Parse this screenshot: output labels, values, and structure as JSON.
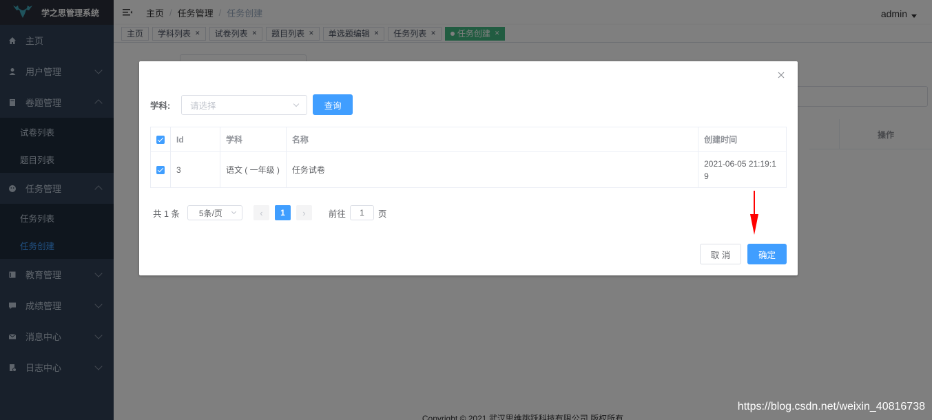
{
  "app_title": "学之思管理系统",
  "sidebar": {
    "items": [
      {
        "label": "主页",
        "icon": "home-icon"
      },
      {
        "label": "用户管理",
        "icon": "user-icon"
      },
      {
        "label": "卷题管理",
        "icon": "book-icon"
      },
      {
        "label": "试卷列表"
      },
      {
        "label": "题目列表"
      },
      {
        "label": "任务管理",
        "icon": "smile-icon"
      },
      {
        "label": "任务列表"
      },
      {
        "label": "任务创建"
      },
      {
        "label": "教育管理",
        "icon": "education-icon"
      },
      {
        "label": "成绩管理",
        "icon": "chat-icon"
      },
      {
        "label": "消息中心",
        "icon": "mail-icon"
      },
      {
        "label": "日志中心",
        "icon": "log-icon"
      }
    ]
  },
  "breadcrumb": [
    "主页",
    "任务管理",
    "任务创建"
  ],
  "user": "admin",
  "tags": [
    "主页",
    "学科列表",
    "试卷列表",
    "题目列表",
    "单选题编辑",
    "任务列表",
    "任务创建"
  ],
  "background": {
    "op_label": "操作",
    "footer": "Copyright © 2021 武汉思维跳跃科技有限公司 版权所有"
  },
  "dialog": {
    "filter_label": "学科:",
    "select_placeholder": "请选择",
    "query_button": "查询",
    "columns": [
      "Id",
      "学科",
      "名称",
      "创建时间"
    ],
    "rows": [
      {
        "id": "3",
        "subject": "语文 ( 一年级 )",
        "name": "任务试卷",
        "created": "2021-06-05 21:19:19"
      }
    ],
    "pagination": {
      "total": "共 1 条",
      "page_size": "5条/页",
      "current": "1",
      "goto_label": "前往",
      "goto_value": "1",
      "page_suffix": "页"
    },
    "cancel_button": "取 消",
    "confirm_button": "确定"
  },
  "watermark": "https://blog.csdn.net/weixin_40816738",
  "colors": {
    "sidebar_bg": "#304156",
    "primary": "#409eff",
    "active_tag": "#42b983",
    "annotation_arrow": "#ff0000"
  }
}
